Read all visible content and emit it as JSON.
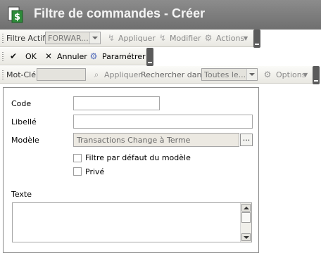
{
  "window": {
    "title": "Filtre de commandes - Créer",
    "icon": "app-dollar-doc-icon"
  },
  "toolbar1": {
    "filter_label": "Filtre Actif",
    "filter_value": "FORWAR...",
    "apply_label": "Appliquer",
    "modify_label": "Modifier",
    "actions_label": "Actions"
  },
  "toolbar2": {
    "ok_label": "OK",
    "cancel_label": "Annuler",
    "settings_label": "Paramétrer"
  },
  "toolbar3": {
    "keyword_label": "Mot-Clé",
    "keyword_value": "",
    "apply_label": "Appliquer",
    "search_in_label": "Rechercher dans",
    "search_in_value": "Toutes le...",
    "options_label": "Options"
  },
  "form": {
    "code_label": "Code",
    "code_value": "",
    "libelle_label": "Libellé",
    "libelle_value": "",
    "modele_label": "Modèle",
    "modele_value": "Transactions Change à Terme",
    "browse_label": "...",
    "default_filter_label": "Filtre par défaut du modèle",
    "private_label": "Privé",
    "texte_label": "Texte",
    "texte_value": ""
  },
  "colors": {
    "titlebar": "#7d7d7d",
    "toolbar": "#f1f0eb",
    "ok_check": "#1a1a1a"
  }
}
